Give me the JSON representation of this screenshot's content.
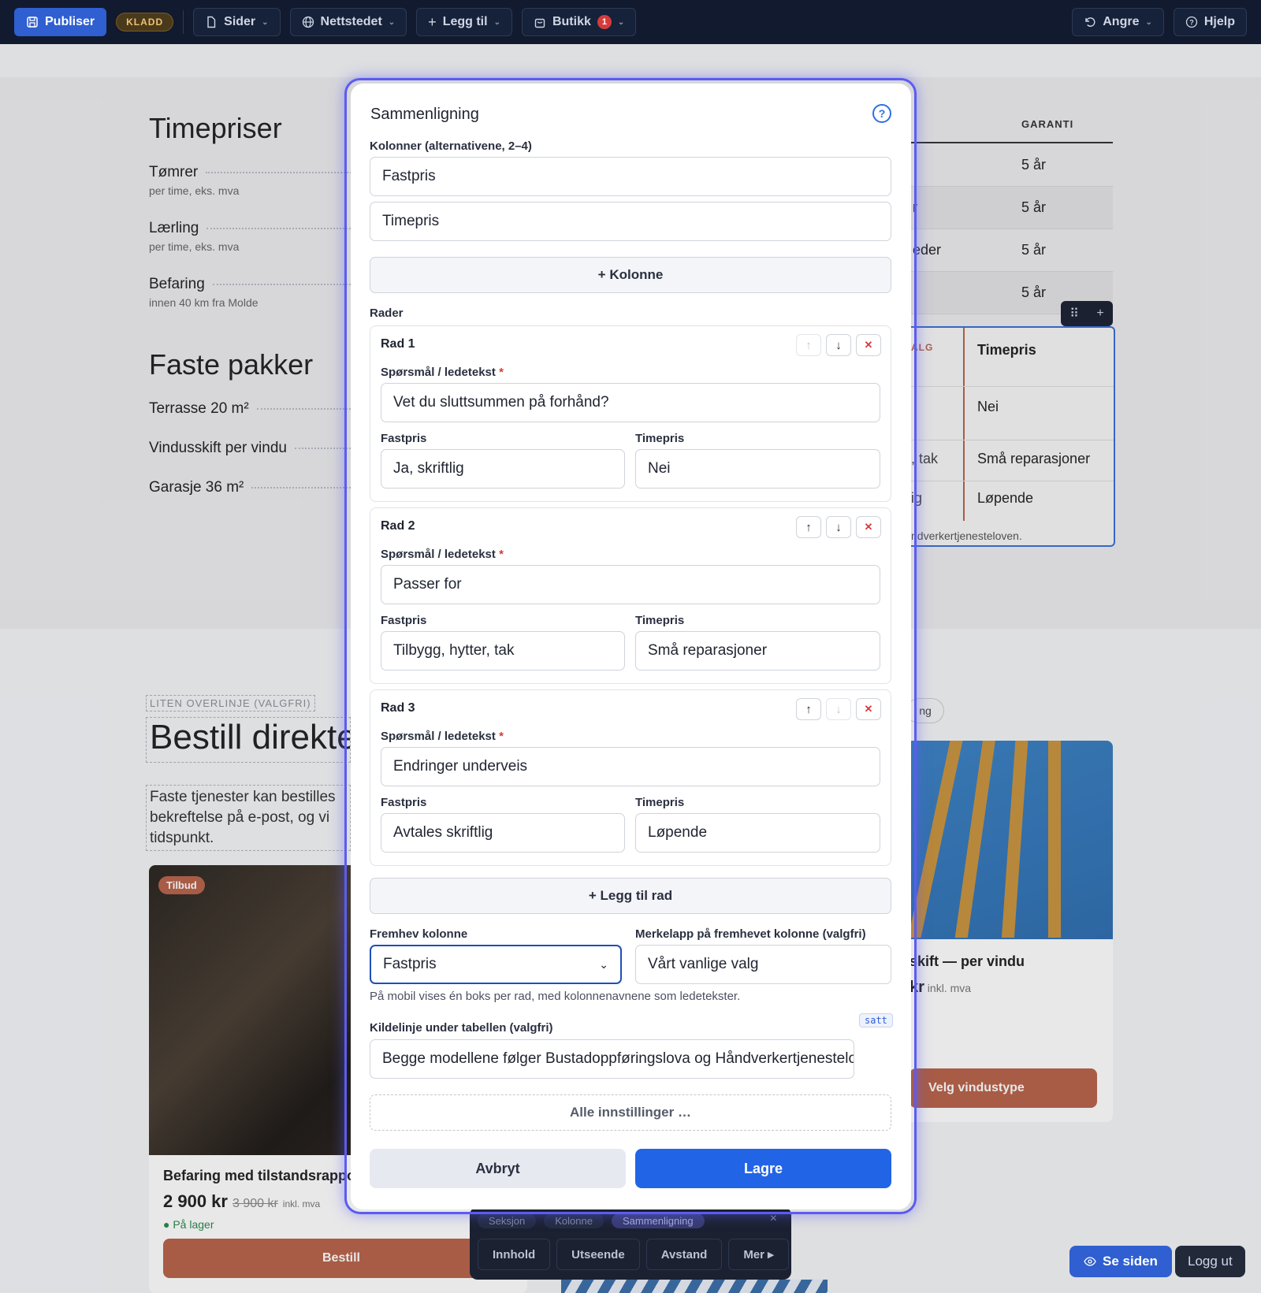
{
  "topbar": {
    "publish": "Publiser",
    "draft_badge": "KLADD",
    "pages": "Sider",
    "website": "Nettstedet",
    "add": "Legg til",
    "shop": "Butikk",
    "shop_count": "1",
    "undo": "Angre",
    "help": "Hjelp"
  },
  "background": {
    "hourly_title": "Timepriser",
    "hourly_items": [
      {
        "name": "Tømrer",
        "sub": "per time, eks. mva"
      },
      {
        "name": "Lærling",
        "sub": "per time, eks. mva"
      },
      {
        "name": "Befaring",
        "sub": "innen 40 km fra Molde"
      }
    ],
    "packages_title": "Faste pakker",
    "packages": [
      "Terrasse 20 m²",
      "Vindusskift per vindu",
      "Garasje 36 m²"
    ],
    "table_header": "GARANTI",
    "table_rows": [
      {
        "c1": "",
        "c2": "5 år"
      },
      {
        "c1": "r",
        "c2": "5 år"
      },
      {
        "c1": "eder",
        "c2": "5 år"
      },
      {
        "c1": "",
        "c2": "5 år"
      }
    ],
    "compare_valg": "ALG",
    "compare_header": "Timepris",
    "compare_cells": [
      {
        "l": "",
        "r": "Nei"
      },
      {
        "l": ", tak",
        "r": "Små reparasjoner"
      },
      {
        "l": "ig",
        "r": "Løpende"
      }
    ],
    "compare_foot": "ndverkertjenesteloven.",
    "overline": "LITEN OVERLINJE (VALGFRI)",
    "order_title": "Bestill direkte",
    "order_text_lines": [
      "Faste tjenester kan bestilles",
      "bekreftelse på e-post, og vi",
      "tidspunkt."
    ],
    "chip": "ng",
    "card_left": {
      "tag": "Tilbud",
      "title": "Befaring med tilstandsrapport",
      "price": "2 900 kr",
      "old_price": "3 900 kr",
      "mva": "inkl. mva",
      "stock": "● På lager",
      "button": "Bestill"
    },
    "card_right": {
      "title": "skift — per vindu",
      "price_suffix": "kr",
      "mva": "inkl. mva",
      "button": "Velg vindustype"
    },
    "dock_tabs": [
      "Seksjon",
      "Kolonne",
      "Sammenligning"
    ],
    "dock_buttons": [
      "Innhold",
      "Utseende",
      "Avstand",
      "Mer ▸"
    ],
    "dock_close": "×",
    "see_site": "Se siden",
    "logout": "Logg ut"
  },
  "modal": {
    "title": "Sammenligning",
    "help": "?",
    "columns_label": "Kolonner (alternativene, 2–4)",
    "columns": [
      "Fastpris",
      "Timepris"
    ],
    "add_column": "+ Kolonne",
    "rows_label": "Rader",
    "question_label": "Spørsmål / ledetekst",
    "required_mark": "*",
    "rows": [
      {
        "title": "Rad 1",
        "question": "Vet du sluttsummen på forhånd?",
        "col1_label": "Fastpris",
        "col1": "Ja, skriftlig",
        "col2_label": "Timepris",
        "col2": "Nei"
      },
      {
        "title": "Rad 2",
        "question": "Passer for",
        "col1_label": "Fastpris",
        "col1": "Tilbygg, hytter, tak",
        "col2_label": "Timepris",
        "col2": "Små reparasjoner"
      },
      {
        "title": "Rad 3",
        "question": "Endringer underveis",
        "col1_label": "Fastpris",
        "col1": "Avtales skriftlig",
        "col2_label": "Timepris",
        "col2": "Løpende"
      }
    ],
    "add_row": "+ Legg til rad",
    "highlight_label": "Fremhev kolonne",
    "highlight_value": "Fastpris",
    "badge_label": "Merkelapp på fremhevet kolonne (valgfri)",
    "badge_value": "Vårt vanlige valg",
    "mobile_hint": "På mobil vises én boks per rad, med kolonnenavnene som ledetekster.",
    "set_tag": "satt",
    "source_label": "Kildelinje under tabellen (valgfri)",
    "source_value": "Begge modellene følger Bustadoppføringslova og Håndverkertjenesteloven.",
    "all_settings": "Alle innstillinger …",
    "cancel": "Avbryt",
    "save": "Lagre"
  },
  "colors": {
    "topbar_bg": "#111a2e",
    "primary": "#2264e6",
    "modal_glow": "#5b5cf0",
    "accent": "#b8644a",
    "danger": "#d63b3b"
  }
}
